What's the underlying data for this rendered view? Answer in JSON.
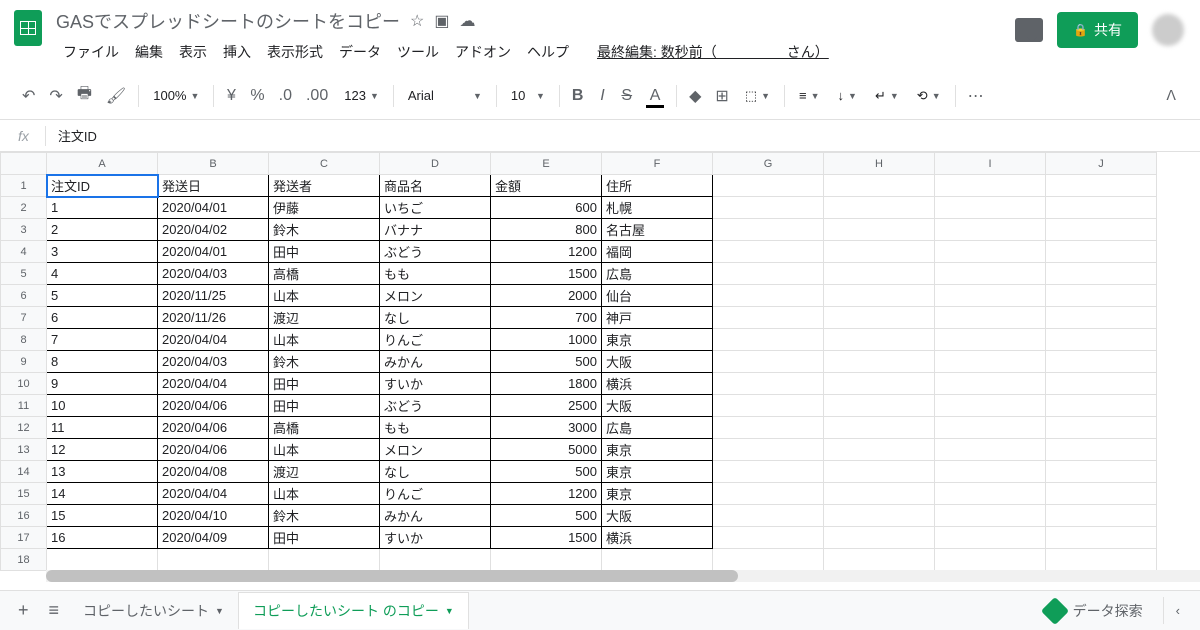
{
  "doc_title": "GASでスプレッドシートのシートをコピー",
  "menus": [
    "ファイル",
    "編集",
    "表示",
    "挿入",
    "表示形式",
    "データ",
    "ツール",
    "アドオン",
    "ヘルプ"
  ],
  "last_edit": "最終編集: 数秒前（　　　　　さん）",
  "share_label": "共有",
  "toolbar": {
    "zoom": "100%",
    "font": "Arial",
    "font_size": "10"
  },
  "formula": {
    "value": "注文ID"
  },
  "columns": [
    "A",
    "B",
    "C",
    "D",
    "E",
    "F",
    "G",
    "H",
    "I",
    "J"
  ],
  "headers": [
    "注文ID",
    "発送日",
    "発送者",
    "商品名",
    "金額",
    "住所"
  ],
  "rows": [
    [
      "1",
      "2020/04/01",
      "伊藤",
      "いちご",
      "600",
      "札幌"
    ],
    [
      "2",
      "2020/04/02",
      "鈴木",
      "バナナ",
      "800",
      "名古屋"
    ],
    [
      "3",
      "2020/04/01",
      "田中",
      "ぶどう",
      "1200",
      "福岡"
    ],
    [
      "4",
      "2020/04/03",
      "高橋",
      "もも",
      "1500",
      "広島"
    ],
    [
      "5",
      "2020/11/25",
      "山本",
      "メロン",
      "2000",
      "仙台"
    ],
    [
      "6",
      "2020/11/26",
      "渡辺",
      "なし",
      "700",
      "神戸"
    ],
    [
      "7",
      "2020/04/04",
      "山本",
      "りんご",
      "1000",
      "東京"
    ],
    [
      "8",
      "2020/04/03",
      "鈴木",
      "みかん",
      "500",
      "大阪"
    ],
    [
      "9",
      "2020/04/04",
      "田中",
      "すいか",
      "1800",
      "横浜"
    ],
    [
      "10",
      "2020/04/06",
      "田中",
      "ぶどう",
      "2500",
      "大阪"
    ],
    [
      "11",
      "2020/04/06",
      "高橋",
      "もも",
      "3000",
      "広島"
    ],
    [
      "12",
      "2020/04/06",
      "山本",
      "メロン",
      "5000",
      "東京"
    ],
    [
      "13",
      "2020/04/08",
      "渡辺",
      "なし",
      "500",
      "東京"
    ],
    [
      "14",
      "2020/04/04",
      "山本",
      "りんご",
      "1200",
      "東京"
    ],
    [
      "15",
      "2020/04/10",
      "鈴木",
      "みかん",
      "500",
      "大阪"
    ],
    [
      "16",
      "2020/04/09",
      "田中",
      "すいか",
      "1500",
      "横浜"
    ]
  ],
  "tabs": {
    "tab1": "コピーしたいシート",
    "tab2": "コピーしたいシート のコピー"
  },
  "explore_label": "データ探索"
}
